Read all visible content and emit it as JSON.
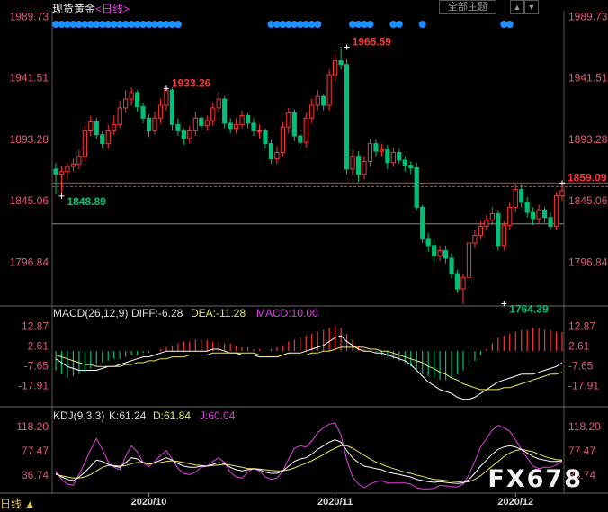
{
  "header": {
    "instrument": "现货黄金",
    "period_label": "<日线>",
    "theme_button": "全部主题",
    "up_button": "▲",
    "down_button": "▼"
  },
  "bottom_bar": {
    "period_toggle": "日线 ▲"
  },
  "watermark": "FX678",
  "colors": {
    "up": "#ff3333",
    "down": "#00c077",
    "price_axis": "#e05a78",
    "dif": "#ffffff",
    "dea": "#e8e86a",
    "macd_label": "#e040e0",
    "k": "#ffffff",
    "d": "#e8e86a",
    "j": "#e040e0",
    "marker": "#1e90ff",
    "reference_line": "#ff3030"
  },
  "chart_data": [
    {
      "type": "candlestick",
      "title": "现货黄金<日线>",
      "y_ticks": [
        "1989.73",
        "1941.51",
        "1893.28",
        "1845.06",
        "1796.84"
      ],
      "ylim": [
        1764,
        1990
      ],
      "x_ticks": [
        {
          "label": "2020/10",
          "index": 16
        },
        {
          "label": "2020/11",
          "index": 48
        },
        {
          "label": "2020/12",
          "index": 79
        }
      ],
      "annotations": [
        {
          "label": "1933.26",
          "index": 19,
          "value": 1933.26
        },
        {
          "label": "1965.59",
          "index": 50,
          "value": 1965.59
        },
        {
          "label": "1848.89",
          "index": 1,
          "value": 1848.89
        },
        {
          "label": "1764.39",
          "index": 77,
          "value": 1764.39
        },
        {
          "label": "1859.09",
          "index": 87,
          "value": 1859.09
        }
      ],
      "reference_lines": [
        1859.09,
        1827.0
      ],
      "marker_indices": [
        0,
        1,
        2,
        3,
        4,
        5,
        6,
        7,
        8,
        9,
        10,
        11,
        12,
        13,
        14,
        15,
        16,
        17,
        18,
        19,
        20,
        21,
        22,
        23,
        24,
        25,
        26,
        27,
        28,
        29,
        30,
        31,
        32,
        33,
        34,
        35,
        36,
        37,
        38,
        39,
        40,
        41,
        42,
        43,
        44,
        45,
        46,
        47,
        48,
        49,
        50,
        51,
        52,
        53,
        54,
        55,
        56,
        57,
        58,
        59,
        60,
        61,
        62,
        63,
        64,
        65,
        66,
        67,
        68,
        69,
        70,
        71,
        72,
        73,
        74,
        75,
        76,
        77,
        78,
        79,
        80,
        81,
        82,
        83,
        84,
        85,
        86,
        87
      ],
      "candles": {
        "open": [
          1870,
          1866,
          1868,
          1872,
          1874,
          1880,
          1900,
          1907,
          1897,
          1890,
          1900,
          1905,
          1918,
          1925,
          1930,
          1919,
          1910,
          1900,
          1910,
          1920,
          1932,
          1905,
          1900,
          1894,
          1900,
          1910,
          1904,
          1908,
          1918,
          1925,
          1906,
          1902,
          1905,
          1912,
          1906,
          1900,
          1900,
          1890,
          1878,
          1883,
          1903,
          1914,
          1896,
          1891,
          1910,
          1920,
          1927,
          1920,
          1944,
          1955,
          1952,
          1870,
          1880,
          1866,
          1876,
          1890,
          1884,
          1885,
          1875,
          1883,
          1877,
          1873,
          1871,
          1840,
          1815,
          1810,
          1802,
          1806,
          1800,
          1788,
          1776,
          1785,
          1812,
          1818,
          1825,
          1830,
          1835,
          1810,
          1826,
          1840,
          1854,
          1844,
          1836,
          1831,
          1838,
          1832,
          1825,
          1849
        ],
        "close": [
          1866,
          1868,
          1872,
          1874,
          1880,
          1900,
          1907,
          1897,
          1890,
          1900,
          1905,
          1918,
          1925,
          1930,
          1919,
          1910,
          1900,
          1910,
          1920,
          1932,
          1905,
          1900,
          1894,
          1900,
          1910,
          1904,
          1908,
          1918,
          1925,
          1906,
          1902,
          1905,
          1912,
          1906,
          1900,
          1900,
          1890,
          1878,
          1883,
          1903,
          1914,
          1896,
          1891,
          1910,
          1920,
          1927,
          1920,
          1944,
          1955,
          1952,
          1870,
          1880,
          1866,
          1876,
          1890,
          1884,
          1885,
          1875,
          1883,
          1877,
          1873,
          1871,
          1840,
          1815,
          1810,
          1802,
          1806,
          1800,
          1788,
          1776,
          1785,
          1812,
          1818,
          1825,
          1830,
          1835,
          1810,
          1826,
          1840,
          1854,
          1844,
          1836,
          1831,
          1838,
          1832,
          1825,
          1849,
          1853
        ],
        "high": [
          1875,
          1872,
          1875,
          1878,
          1885,
          1904,
          1912,
          1910,
          1900,
          1905,
          1912,
          1924,
          1932,
          1934,
          1932,
          1922,
          1913,
          1915,
          1925,
          1936,
          1934,
          1910,
          1902,
          1904,
          1915,
          1912,
          1912,
          1922,
          1930,
          1927,
          1910,
          1910,
          1916,
          1914,
          1910,
          1905,
          1902,
          1893,
          1888,
          1907,
          1918,
          1917,
          1900,
          1914,
          1925,
          1932,
          1929,
          1948,
          1960,
          1966,
          1956,
          1885,
          1884,
          1880,
          1894,
          1893,
          1890,
          1889,
          1887,
          1886,
          1880,
          1876,
          1875,
          1842,
          1820,
          1814,
          1810,
          1810,
          1804,
          1791,
          1788,
          1815,
          1822,
          1829,
          1834,
          1840,
          1838,
          1829,
          1844,
          1858,
          1858,
          1848,
          1840,
          1842,
          1840,
          1836,
          1852,
          1860
        ],
        "low": [
          1850,
          1849,
          1862,
          1868,
          1870,
          1876,
          1896,
          1894,
          1886,
          1886,
          1897,
          1902,
          1914,
          1920,
          1915,
          1906,
          1895,
          1897,
          1906,
          1916,
          1900,
          1896,
          1889,
          1890,
          1896,
          1900,
          1900,
          1904,
          1914,
          1902,
          1898,
          1898,
          1902,
          1902,
          1896,
          1894,
          1886,
          1874,
          1874,
          1880,
          1898,
          1892,
          1886,
          1887,
          1906,
          1916,
          1916,
          1916,
          1940,
          1948,
          1866,
          1865,
          1860,
          1862,
          1872,
          1880,
          1880,
          1870,
          1872,
          1874,
          1868,
          1866,
          1838,
          1812,
          1805,
          1797,
          1798,
          1796,
          1784,
          1773,
          1764,
          1781,
          1808,
          1815,
          1822,
          1826,
          1806,
          1806,
          1822,
          1836,
          1840,
          1832,
          1826,
          1827,
          1828,
          1822,
          1822,
          1845
        ]
      }
    },
    {
      "type": "bar",
      "title": "MACD(26,12,9)",
      "legend": [
        {
          "name": "DIFF",
          "value": "-6.28"
        },
        {
          "name": "DEA",
          "value": "-11.28"
        },
        {
          "name": "MACD",
          "value": "10.00"
        }
      ],
      "y_ticks": [
        "12.87",
        "2.61",
        "-7.65",
        "-17.91"
      ],
      "ylim": [
        -28,
        16
      ],
      "histogram": [
        -10,
        -12,
        -14,
        -13,
        -12,
        -11,
        -9,
        -8,
        -6,
        -5,
        -4,
        -4,
        -3,
        -2,
        -2,
        -1,
        -1,
        0,
        1,
        2,
        3,
        4,
        5,
        5,
        6,
        6,
        6,
        5,
        5,
        4,
        4,
        3,
        2,
        2,
        1,
        1,
        0,
        1,
        2,
        3,
        5,
        6,
        7,
        8,
        9,
        10,
        11,
        12,
        13,
        12,
        9,
        6,
        3,
        1,
        0,
        -1,
        -2,
        -3,
        -4,
        -5,
        -6,
        -8,
        -10,
        -12,
        -13,
        -14,
        -15,
        -15,
        -14,
        -12,
        -10,
        -8,
        -5,
        -2,
        1,
        4,
        7,
        8,
        9,
        10,
        11,
        11,
        12,
        12,
        11,
        11,
        10,
        10
      ],
      "dif": [
        -4,
        -6,
        -8,
        -9,
        -10,
        -10,
        -10,
        -10,
        -9,
        -8,
        -8,
        -7,
        -6,
        -5,
        -4,
        -3,
        -3,
        -2,
        -1,
        0,
        0,
        0,
        0,
        0,
        0,
        0,
        0,
        1,
        1,
        0,
        -1,
        -1,
        -2,
        -2,
        -2,
        -3,
        -3,
        -3,
        -3,
        -2,
        -1,
        -1,
        -1,
        0,
        1,
        2,
        3,
        5,
        7,
        8,
        5,
        3,
        1,
        0,
        0,
        -1,
        -1,
        -2,
        -3,
        -4,
        -5,
        -7,
        -10,
        -13,
        -16,
        -18,
        -20,
        -21,
        -22,
        -24,
        -25,
        -25,
        -24,
        -22,
        -20,
        -18,
        -16,
        -15,
        -14,
        -13,
        -12,
        -12,
        -12,
        -11,
        -10,
        -9,
        -8,
        -6
      ],
      "dea": [
        -2,
        -3,
        -4,
        -5,
        -6,
        -7,
        -7,
        -8,
        -8,
        -8,
        -8,
        -8,
        -7,
        -7,
        -6,
        -6,
        -5,
        -5,
        -4,
        -4,
        -3,
        -3,
        -3,
        -2,
        -2,
        -2,
        -2,
        -1,
        -1,
        -1,
        -1,
        -1,
        -1,
        -1,
        -1,
        -2,
        -2,
        -2,
        -2,
        -2,
        -2,
        -2,
        -2,
        -2,
        -1,
        -1,
        0,
        0,
        1,
        2,
        2,
        2,
        2,
        2,
        1,
        1,
        0,
        0,
        -1,
        -2,
        -3,
        -4,
        -5,
        -6,
        -8,
        -9,
        -11,
        -12,
        -14,
        -15,
        -17,
        -18,
        -19,
        -20,
        -20,
        -20,
        -20,
        -19,
        -19,
        -18,
        -17,
        -16,
        -15,
        -14,
        -13,
        -12,
        -12,
        -11
      ]
    },
    {
      "type": "line",
      "title": "KDJ(9,3,3)",
      "legend": [
        {
          "name": "K",
          "value": "61.24"
        },
        {
          "name": "D",
          "value": "61.84"
        },
        {
          "name": "J",
          "value": "60.04"
        }
      ],
      "y_ticks": [
        "118.20",
        "77.47",
        "36.74"
      ],
      "ylim": [
        10,
        130
      ],
      "k": [
        40,
        34,
        30,
        28,
        34,
        42,
        52,
        62,
        60,
        55,
        52,
        50,
        58,
        66,
        64,
        58,
        55,
        58,
        62,
        66,
        62,
        56,
        52,
        50,
        50,
        52,
        52,
        55,
        58,
        56,
        50,
        46,
        44,
        46,
        48,
        46,
        42,
        40,
        40,
        44,
        52,
        60,
        64,
        66,
        72,
        80,
        86,
        92,
        96,
        92,
        78,
        66,
        58,
        52,
        50,
        48,
        46,
        42,
        40,
        38,
        36,
        34,
        30,
        28,
        26,
        25,
        26,
        25,
        24,
        23,
        24,
        30,
        40,
        52,
        62,
        72,
        80,
        84,
        86,
        84,
        80,
        74,
        68,
        64,
        62,
        60,
        60,
        61
      ],
      "d": [
        38,
        36,
        34,
        32,
        32,
        34,
        38,
        44,
        50,
        53,
        53,
        52,
        53,
        56,
        58,
        58,
        57,
        57,
        58,
        60,
        61,
        60,
        58,
        56,
        54,
        53,
        52,
        53,
        54,
        55,
        54,
        52,
        50,
        48,
        48,
        47,
        46,
        45,
        44,
        44,
        46,
        49,
        53,
        57,
        61,
        66,
        71,
        77,
        82,
        86,
        86,
        82,
        76,
        70,
        64,
        59,
        55,
        51,
        48,
        45,
        42,
        40,
        37,
        35,
        32,
        30,
        29,
        28,
        27,
        26,
        25,
        26,
        30,
        36,
        44,
        52,
        60,
        68,
        74,
        78,
        80,
        78,
        76,
        72,
        68,
        65,
        63,
        62
      ],
      "j": [
        44,
        30,
        22,
        20,
        38,
        58,
        80,
        98,
        80,
        60,
        50,
        46,
        68,
        86,
        76,
        58,
        51,
        60,
        70,
        78,
        64,
        48,
        40,
        38,
        42,
        50,
        52,
        60,
        66,
        58,
        42,
        34,
        32,
        42,
        48,
        44,
        34,
        30,
        32,
        44,
        64,
        82,
        86,
        84,
        94,
        108,
        116,
        122,
        124,
        104,
        62,
        34,
        22,
        16,
        22,
        26,
        28,
        24,
        24,
        24,
        24,
        22,
        16,
        14,
        14,
        15,
        20,
        19,
        18,
        17,
        22,
        38,
        60,
        84,
        98,
        112,
        120,
        116,
        110,
        96,
        80,
        66,
        52,
        48,
        50,
        50,
        54,
        60
      ]
    }
  ]
}
